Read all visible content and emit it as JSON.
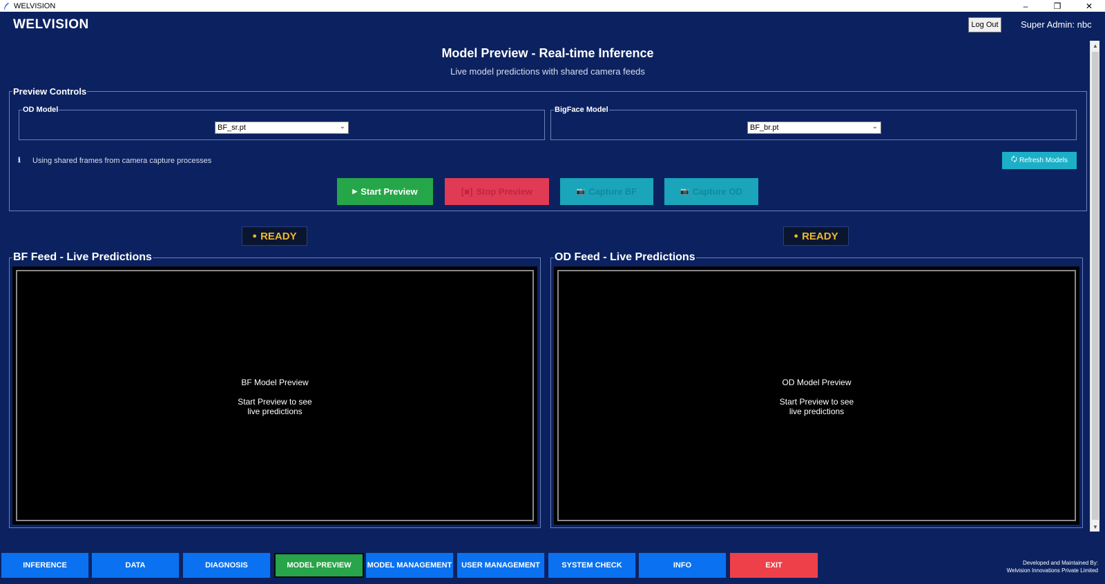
{
  "window": {
    "title": "WELVISION",
    "minimize": "–",
    "maximize": "❐",
    "close": "✕"
  },
  "header": {
    "brand": "WELVISION",
    "logout_label": "Log Out",
    "user_label": "Super Admin: nbc"
  },
  "page": {
    "title": "Model Preview - Real-time Inference",
    "subtitle": "Live model predictions with shared camera feeds"
  },
  "controls": {
    "legend": "Preview Controls",
    "od_model": {
      "label": "OD Model",
      "selected": "BF_sr.pt"
    },
    "bf_model": {
      "label": "BigFace Model",
      "selected": "BF_br.pt"
    },
    "info_icon": "ℹ",
    "info_text": "Using shared frames from camera capture processes",
    "refresh_icon": "🗘",
    "refresh_label": "Refresh Models",
    "start": {
      "icon": "▶",
      "label": "Start Preview"
    },
    "stop": {
      "icon": "[■]",
      "label": "Stop Preview"
    },
    "capture_bf": {
      "icon": "📷",
      "label": "Capture BF"
    },
    "capture_od": {
      "icon": "📷",
      "label": "Capture OD"
    }
  },
  "status": {
    "bf": {
      "dot": "●",
      "text": "READY"
    },
    "od": {
      "dot": "●",
      "text": "READY"
    },
    "color": "#f1b82d"
  },
  "feeds": {
    "bf": {
      "legend": "BF Feed - Live Predictions",
      "line1": "BF Model Preview",
      "line2": "Start Preview to see",
      "line3": "live predictions"
    },
    "od": {
      "legend": "OD Feed - Live Predictions",
      "line1": "OD Model Preview",
      "line2": "Start Preview to see",
      "line3": "live predictions"
    }
  },
  "nav": {
    "items": [
      "INFERENCE",
      "DATA",
      "DIAGNOSIS",
      "MODEL PREVIEW",
      "MODEL MANAGEMENT",
      "USER MANAGEMENT",
      "SYSTEM CHECK",
      "INFO",
      "EXIT"
    ],
    "active": "MODEL PREVIEW"
  },
  "footer": {
    "credit_line1": "Developed and Maintained By:",
    "credit_line2": "Welvision Innovations Private Limited"
  },
  "colors": {
    "background": "#0c2260",
    "nav_blue": "#0a72f0",
    "active_green": "#28a44a",
    "exit_red": "#ee4049",
    "accent_teal": "#1bb0c8"
  }
}
